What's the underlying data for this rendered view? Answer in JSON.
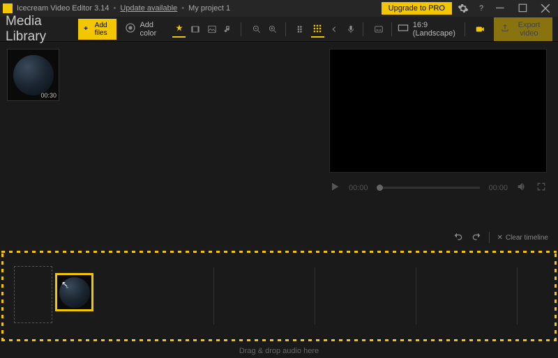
{
  "titlebar": {
    "app_name": "Icecream Video Editor 3.14",
    "update_link": "Update available",
    "project_name": "My project 1",
    "upgrade_label": "Upgrade to PRO"
  },
  "toolbar": {
    "library_title": "Media Library",
    "add_files_label": "Add files",
    "add_color_label": "Add color",
    "aspect_ratio": "16:9 (Landscape)",
    "export_label": "Export video"
  },
  "media": {
    "items": [
      {
        "duration": "00:30"
      }
    ]
  },
  "preview": {
    "current_time": "00:00",
    "total_time": "00:00"
  },
  "actions": {
    "clear_timeline_label": "Clear timeline"
  },
  "audio_drop": {
    "hint": "Drag & drop audio here"
  }
}
